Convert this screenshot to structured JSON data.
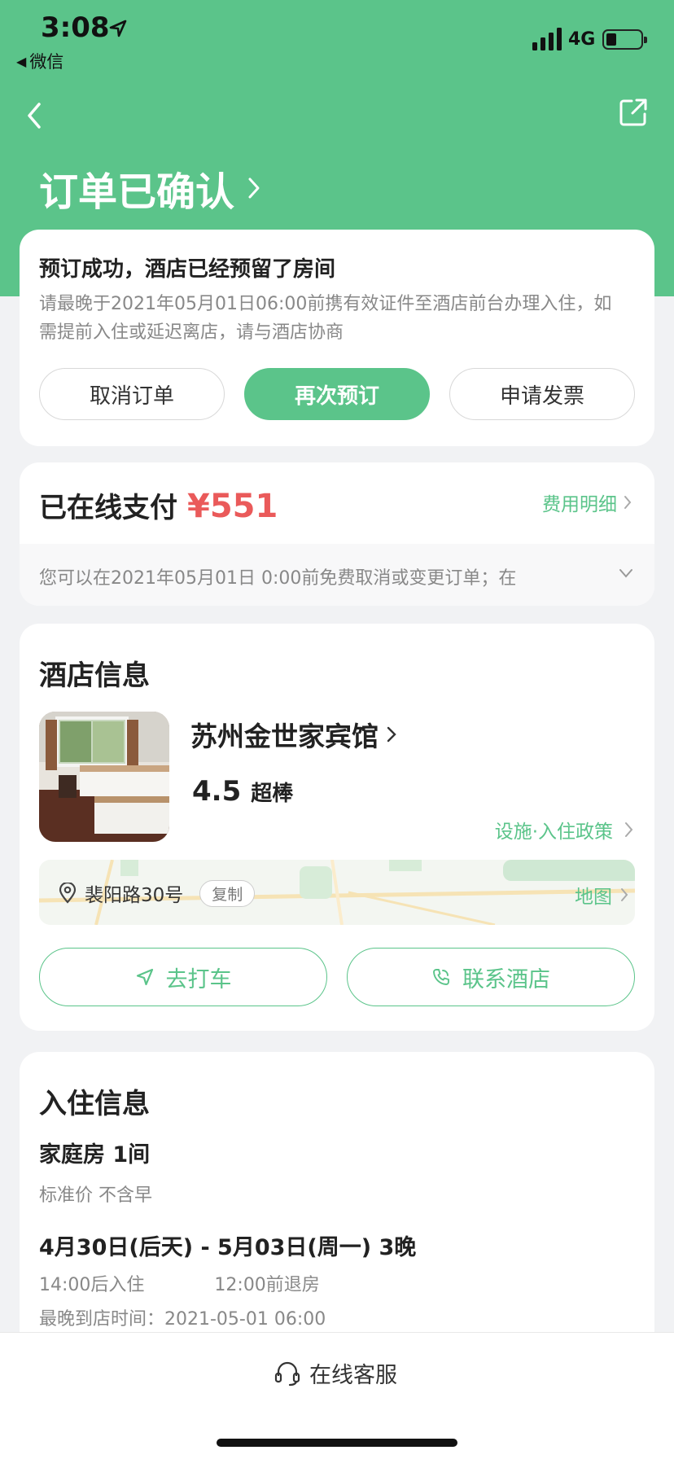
{
  "status_bar": {
    "time": "3:08",
    "back_app": "微信",
    "network": "4G"
  },
  "header": {
    "title": "订单已确认"
  },
  "confirmation": {
    "title": "预订成功，酒店已经预留了房间",
    "description": "请最晚于2021年05月01日06:00前携有效证件至酒店前台办理入住，如需提前入住或延迟离店，请与酒店协商",
    "buttons": {
      "cancel": "取消订单",
      "rebook": "再次预订",
      "invoice": "申请发票"
    }
  },
  "payment": {
    "label": "已在线支付",
    "amount": "¥551",
    "fee_detail": "费用明细",
    "cancel_policy": "您可以在2021年05月01日 0:00前免费取消或变更订单；在"
  },
  "hotel": {
    "section_title": "酒店信息",
    "name": "苏州金世家宾馆",
    "rating": "4.5",
    "rating_label": "超棒",
    "policy_link": "设施·入住政策",
    "address": "裴阳路30号",
    "copy_label": "复制",
    "map_label": "地图",
    "taxi_button": "去打车",
    "contact_button": "联系酒店"
  },
  "stay": {
    "section_title": "入住信息",
    "room": "家庭房 1间",
    "rate_plan": "标准价 不含早",
    "dates": "4月30日(后天) - 5月03日(周一)  3晚",
    "check_in": "14:00后入住",
    "check_out": "12:00前退房",
    "latest_arrival": "最晚到店时间：2021-05-01 06:00"
  },
  "bottom": {
    "service": "在线客服"
  },
  "colors": {
    "brand": "#5bc48a",
    "price": "#ea5a5a"
  }
}
